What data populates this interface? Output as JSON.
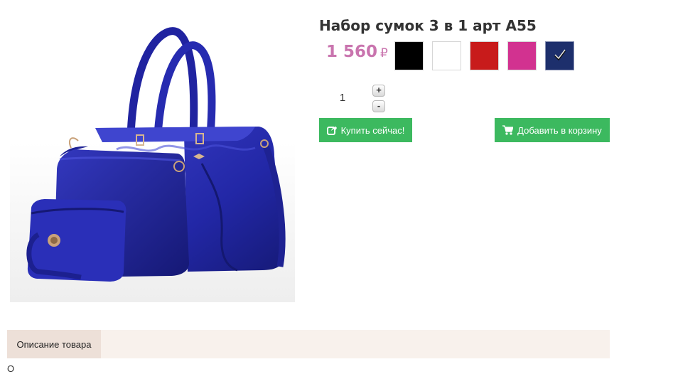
{
  "product": {
    "title": "Набор сумок 3 в 1 арт A55",
    "image_alt": "blue handbag set",
    "price": "1 560",
    "currency": "₽"
  },
  "colors": [
    {
      "name": "black",
      "color": "#000000"
    },
    {
      "name": "white",
      "color": "#ffffff"
    },
    {
      "name": "red",
      "color": "#c81b1b"
    },
    {
      "name": "pink",
      "color": "#d23290"
    },
    {
      "name": "navy",
      "color": "#1d2f6c",
      "selected": true
    }
  ],
  "quantity": {
    "value": "1",
    "plus_label": "+",
    "minus_label": "-"
  },
  "buttons": {
    "buy_now": "Купить сейчас!",
    "add_to_cart": "Добавить в корзину"
  },
  "tabs": {
    "description": "Описание товара"
  },
  "description_text": "О"
}
